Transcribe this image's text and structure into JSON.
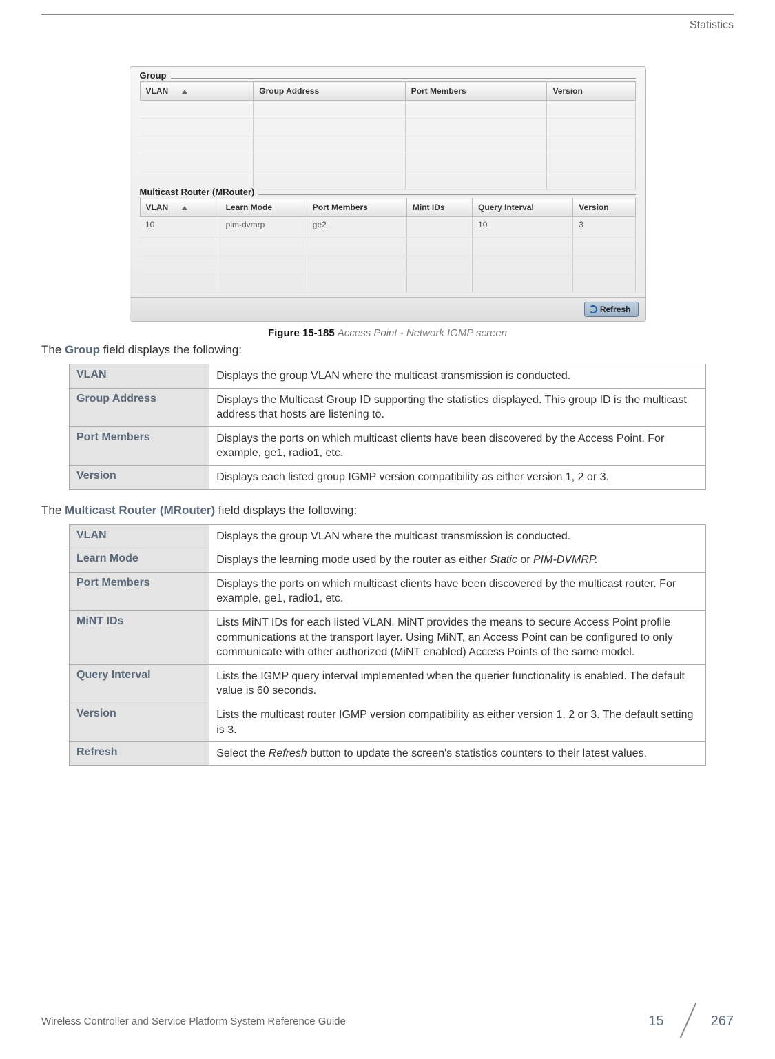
{
  "header": {
    "section": "Statistics"
  },
  "screenshot": {
    "group_fieldset": {
      "legend": "Group",
      "columns": [
        "VLAN",
        "Group Address",
        "Port Members",
        "Version"
      ]
    },
    "mrouter_fieldset": {
      "legend": "Multicast Router (MRouter)",
      "columns": [
        "VLAN",
        "Learn Mode",
        "Port Members",
        "Mint IDs",
        "Query Interval",
        "Version"
      ],
      "rows": [
        {
          "vlan": "10",
          "learn_mode": "pim-dvmrp",
          "port_members": "ge2",
          "mint_ids": "",
          "query_interval": "10",
          "version": "3"
        }
      ]
    },
    "refresh_label": "Refresh"
  },
  "figure": {
    "number": "Figure 15-185",
    "title": "Access Point - Network IGMP screen"
  },
  "group_intro": {
    "prefix": "The ",
    "term": "Group",
    "suffix": " field displays the following:"
  },
  "group_table": [
    {
      "label": "VLAN",
      "value": "Displays the group VLAN where the multicast transmission is conducted."
    },
    {
      "label": "Group Address",
      "value": "Displays the Multicast Group ID supporting the statistics displayed. This group ID is the multicast address that hosts are listening to."
    },
    {
      "label": "Port Members",
      "value": "Displays the ports on which multicast clients have been discovered by the Access Point. For example, ge1, radio1, etc."
    },
    {
      "label": "Version",
      "value": "Displays each listed group IGMP version compatibility as either version 1, 2 or 3."
    }
  ],
  "mrouter_intro": {
    "prefix": "The ",
    "term": "Multicast Router (MRouter)",
    "suffix": " field displays the following:"
  },
  "mrouter_table": [
    {
      "label": "VLAN",
      "value": "Displays the group VLAN where the multicast transmission is conducted."
    },
    {
      "label": "Learn Mode",
      "value_html": "Displays the learning mode used by the router as either <span class='italic'>Static</span> or <span class='italic'>PIM-DVMRP.</span>"
    },
    {
      "label": "Port Members",
      "value": "Displays the ports on which multicast clients have been discovered by the multicast router. For example, ge1, radio1, etc."
    },
    {
      "label": "MiNT IDs",
      "value": "Lists MiNT IDs for each listed VLAN. MiNT provides the means to secure Access Point profile communications at the transport layer. Using MiNT, an Access Point can be configured to only communicate with other authorized (MiNT enabled) Access Points of the same model."
    },
    {
      "label": "Query Interval",
      "value": "Lists the IGMP query interval implemented when the querier functionality is enabled. The default value is 60 seconds."
    },
    {
      "label": "Version",
      "value": "Lists the multicast router IGMP version compatibility as either version 1, 2 or 3. The default setting is 3."
    },
    {
      "label": "Refresh",
      "value_html": "Select the <span class='italic'>Refresh</span> button to update the screen's statistics counters to their latest values."
    }
  ],
  "footer": {
    "doc_title": "Wireless Controller and Service Platform System Reference Guide",
    "chapter": "15",
    "page": "267"
  }
}
